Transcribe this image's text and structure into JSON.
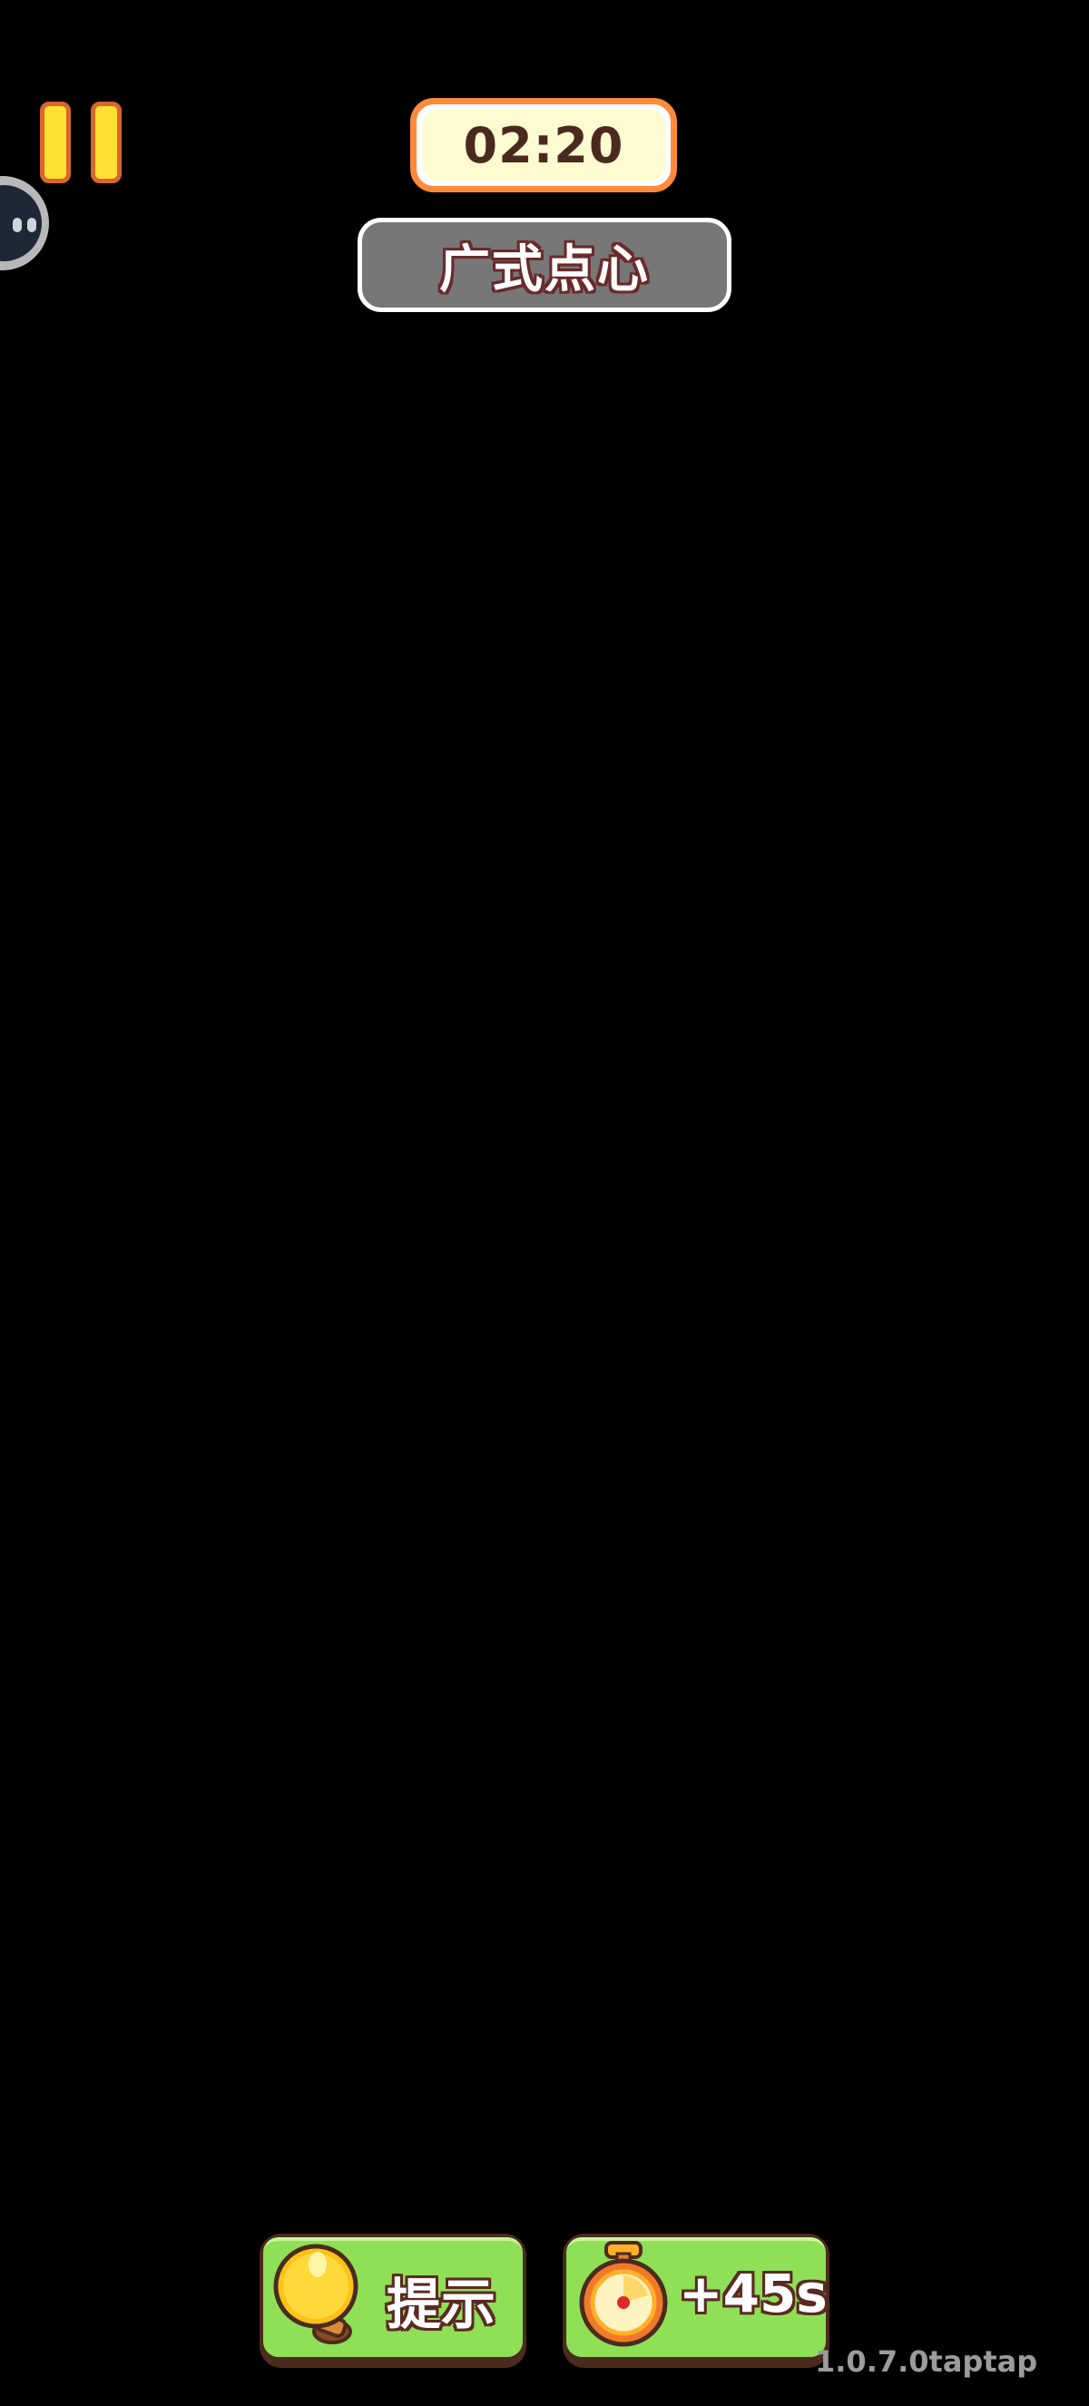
{
  "hud": {
    "timer": "02:20",
    "level_title": "广式点心"
  },
  "buttons": {
    "hint_label": "提示",
    "add_time_label": "+45s"
  },
  "footer": {
    "version": "1.0.7.0taptap"
  },
  "icons": {
    "pause": "pause-icon",
    "assistive": "assistive-touch-icon",
    "hint": "lightbulb-icon",
    "add_time": "stopwatch-icon"
  },
  "colors": {
    "background": "#000000",
    "pause_fill": "#ffe033",
    "timer_border": "#ff8a3c",
    "button_green": "#8fe056",
    "title_bg": "#777777"
  }
}
